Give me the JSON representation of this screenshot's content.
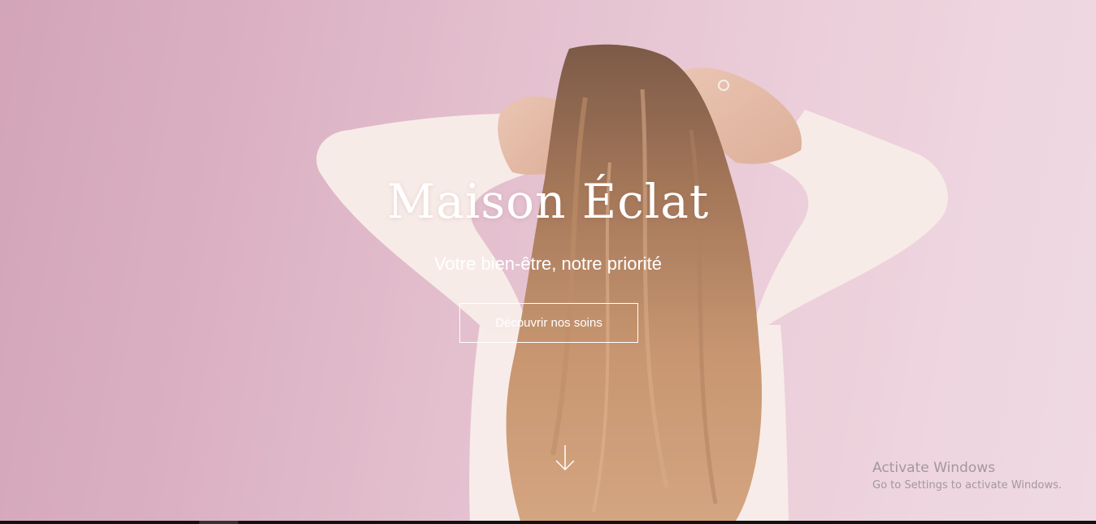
{
  "hero": {
    "title": "Maison Éclat",
    "tagline": "Votre bien-être, notre priorité",
    "cta_label": "Découvrir nos soins",
    "scroll_icon": "arrow-down-icon",
    "background_color": "#e1bccb",
    "text_color": "#ffffff"
  },
  "windows_watermark": {
    "title": "Activate Windows",
    "subtitle": "Go to Settings to activate Windows."
  }
}
